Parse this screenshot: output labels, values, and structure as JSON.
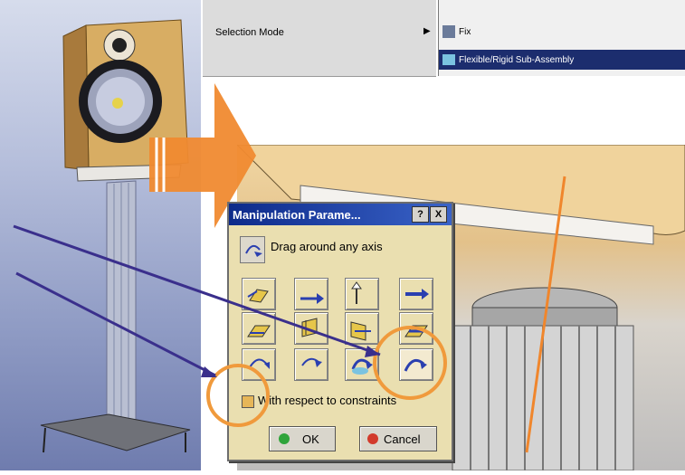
{
  "context_menu": {
    "items": [
      {
        "label": ""
      },
      {
        "label": "Selection Mode"
      }
    ]
  },
  "submenu": {
    "items": [
      {
        "label": ""
      },
      {
        "label": "Fix",
        "selected": false
      },
      {
        "label": "Flexible/Rigid Sub-Assembly",
        "selected": true
      }
    ]
  },
  "dialog": {
    "title": "Manipulation Parame...",
    "help_label": "?",
    "close_label": "X",
    "mode_text": "Drag around any axis",
    "grid_buttons": [
      {
        "icon": "drag-along-x-icon",
        "glyph": "x"
      },
      {
        "icon": "drag-along-y-icon",
        "glyph": "y"
      },
      {
        "icon": "drag-along-z-icon",
        "glyph": "z"
      },
      {
        "icon": "drag-along-any-axis-icon",
        "glyph": ""
      },
      {
        "icon": "drag-along-xy-plane-icon",
        "glyph": "xy"
      },
      {
        "icon": "drag-along-yz-plane-icon",
        "glyph": "yz"
      },
      {
        "icon": "drag-along-xz-plane-icon",
        "glyph": "xz"
      },
      {
        "icon": "drag-along-any-plane-icon",
        "glyph": ""
      },
      {
        "icon": "rotate-around-x-icon",
        "glyph": "x"
      },
      {
        "icon": "rotate-around-y-icon",
        "glyph": "y"
      },
      {
        "icon": "rotate-around-z-icon",
        "glyph": "z"
      },
      {
        "icon": "drag-around-any-axis-icon",
        "glyph": ""
      }
    ],
    "checkbox_label": "With respect to constraints",
    "ok_label": "OK",
    "cancel_label": "Cancel"
  },
  "colors": {
    "title_bar": "#0d2a8a",
    "dialog_bg": "#eadfb0",
    "selection": "#1c2d6e",
    "highlight_circle": "#f09a3c",
    "callout_arrow": "#f08a30",
    "pointer_arrow": "#3a2f8c"
  }
}
